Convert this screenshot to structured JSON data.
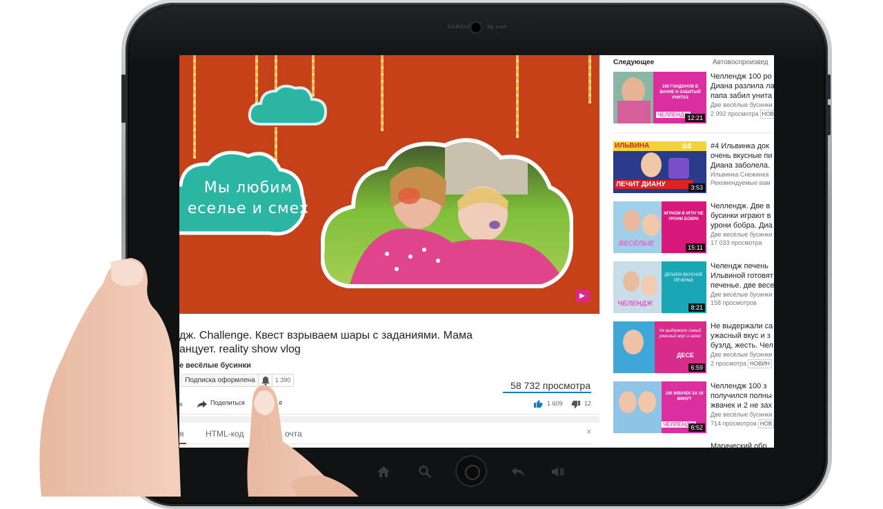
{
  "tablet": {
    "camera_left_text": "SAMSUNG",
    "camera_right_text": "3g.com"
  },
  "video": {
    "overlay_text_line1": "Мы любим",
    "overlay_text_line2": "еселье и смех",
    "accent_color": "#c6401a",
    "cloud_color": "#2bb6a4"
  },
  "info": {
    "title_line1": "дж. Challenge. Квест взрываем шары с заданиями. Мама",
    "title_line2": "анцует. reality show vlog",
    "channel": "е весёлые бусинки",
    "subscribe_label": "Подписка оформлена",
    "subscriber_count": "1 390",
    "views": "58 732 просмотра",
    "action_prefix": "в",
    "share_label": "Поделиться",
    "share_suffix": "ё",
    "likes": "1 609",
    "dislikes": "12"
  },
  "tabs": {
    "tab1": "я",
    "tab2": "HTML-код",
    "tab3": "очта",
    "close": "×"
  },
  "sidebar": {
    "heading": "Следующее",
    "autoplay": "Автовоспроизвед",
    "items": [
      {
        "title1": "Челлендж 100 ро",
        "title2": "Диана разлила ла",
        "title3": "папа забил унита",
        "channel": "Две весёлые бусинки",
        "meta": "2 992 просмотра",
        "badge": "НОВ",
        "duration": "12:21",
        "thumb_text": "100 ГОНДОНОВ В ВАННЕ И ЗАБИТЫЙ УНИТАЗ",
        "thumb_caption": "ЧЕЛЛЕНДЖ"
      },
      {
        "title1": "#4 Ильвинка док",
        "title2": "очень вкусные пи",
        "title3": "Диана заболела.",
        "channel": "Ильвинка Снежинка",
        "meta": "Рекомендуемые вам",
        "badge": "",
        "duration": "3:53",
        "thumb_text": "ИЛЬВИНА",
        "thumb_caption": "ЛЕЧИТ ДИАНУ",
        "thumb_num": "#4"
      },
      {
        "title1": "Челлендж. Две в",
        "title2": "бусинки играют в",
        "title3": "урони бобра. Диа",
        "channel": "Две весёлые бусинки",
        "meta": "17 033 просмотра",
        "badge": "",
        "duration": "15:11",
        "thumb_text": "ИГРАЕМ В ИГРУ НЕ УРОНИ БОБРА",
        "thumb_caption": "ВЕСЁЛЫЕ"
      },
      {
        "title1": "Челендж печень",
        "title2": "Ильвиной готовят",
        "title3": "печенье. две весе",
        "channel": "Две весёлые бусинки",
        "meta": "158 просмотров",
        "badge": "",
        "duration": "8:21",
        "thumb_text": "ДЕЛАЕМ ВКУСНОЕ ПЕЧЕНЬЕ",
        "thumb_caption": "ЧЕЛЕНДЖ"
      },
      {
        "title1": "Не выдержали са",
        "title2": "ужасный вкус и з",
        "title3": "бузлд, жесть. Чел",
        "channel": "Две весёлые бусинки",
        "meta": "2 просмотра",
        "badge": "НОВИН",
        "duration": "6:59",
        "thumb_text": "Не выдержали самый ужасный вкус в запах",
        "thumb_caption": "ДЕСЕ"
      },
      {
        "title1": "Челлендж 100 з",
        "title2": "получился полны",
        "title3": "жвачек и 2 не зах",
        "channel": "Две весёлые бусинки",
        "meta": "714 просмотров",
        "badge": "НОВ",
        "duration": "6:52",
        "thumb_text": "100 ЖВАЧЕК ЗА 10 МИНУТ",
        "thumb_caption": "ЧЕЛЛЕНДЖ"
      },
      {
        "title1": "Магический обр",
        "title2": "",
        "title3": "",
        "channel": "",
        "meta": "",
        "badge": "",
        "duration": "",
        "thumb_text": "",
        "thumb_caption": ""
      }
    ]
  }
}
